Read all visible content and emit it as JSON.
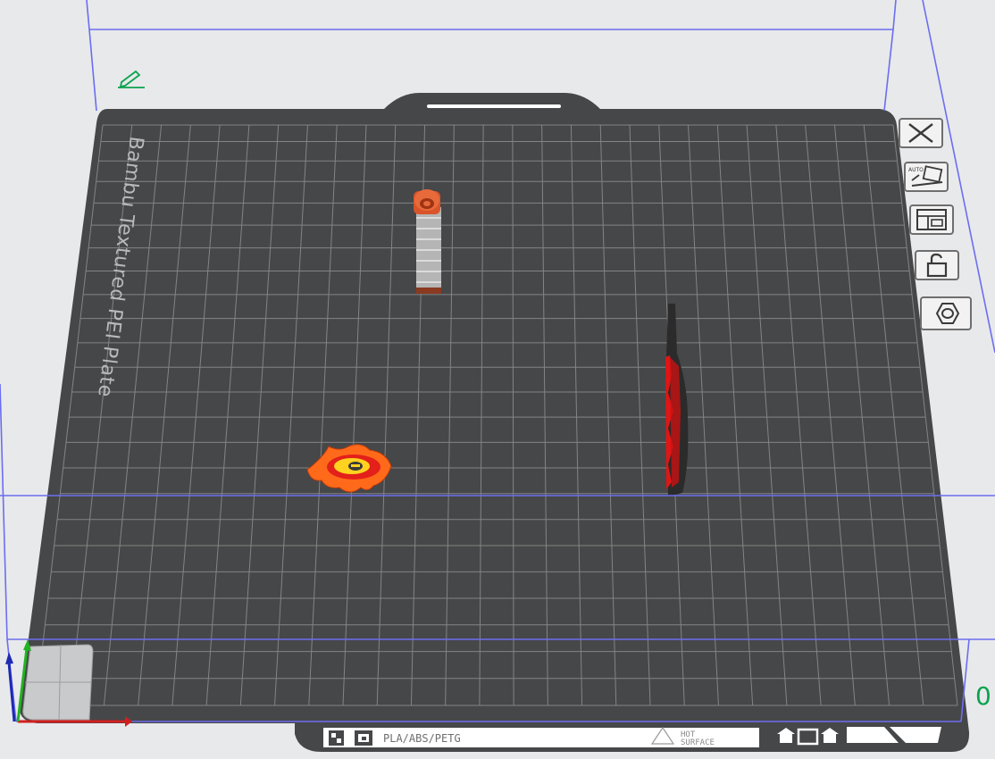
{
  "plate": {
    "name": "Bambu Textured PEI Plate",
    "number": "0",
    "label_filaments": "PLA/ABS/PETG",
    "label_warning_line1": "HOT",
    "label_warning_line2": "SURFACE"
  },
  "colors": {
    "background": "#e8e9eb",
    "bed": "#464748",
    "grid": "#8a8b8c",
    "bounding_box": "#6b6ef0",
    "plate_number": "#0aa34f",
    "edit_icon": "#0aa34f",
    "axis_x": "#d11f1f",
    "axis_y": "#21b321",
    "axis_z": "#1f2ab3"
  },
  "toolbar": {
    "items": [
      {
        "name": "remove-plate",
        "icon": "close-icon"
      },
      {
        "name": "auto-arrange",
        "icon": "auto-orient-icon",
        "text": "AUTO"
      },
      {
        "name": "arrange-objects",
        "icon": "layout-icon"
      },
      {
        "name": "lock-plate",
        "icon": "unlock-icon"
      },
      {
        "name": "plate-settings",
        "icon": "hexagon-settings-icon"
      }
    ]
  },
  "objects": [
    {
      "name": "tower",
      "color": "#e05a2b"
    },
    {
      "name": "flame-badge",
      "color": "#ff6a1a"
    },
    {
      "name": "blade",
      "color": "#2a2a2a"
    }
  ]
}
